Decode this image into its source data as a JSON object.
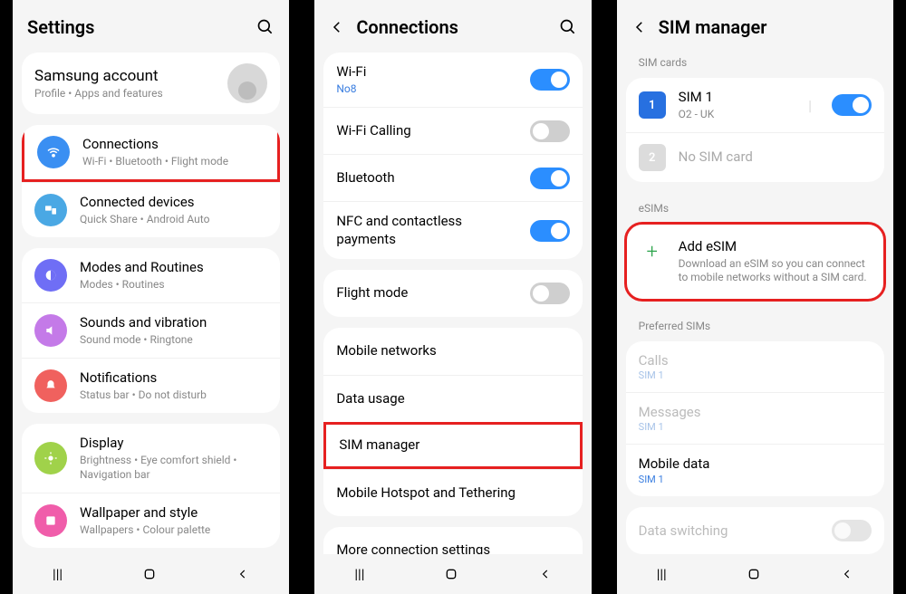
{
  "p1": {
    "title": "Settings",
    "account": {
      "title": "Samsung account",
      "sub": "Profile  •  Apps and features"
    },
    "g1": [
      {
        "label": "Connections",
        "sub": "Wi-Fi  •  Bluetooth  •  Flight mode",
        "color": "#3a8ff2"
      },
      {
        "label": "Connected devices",
        "sub": "Quick Share  •  Android Auto",
        "color": "#4aa8e4"
      }
    ],
    "g2": [
      {
        "label": "Modes and Routines",
        "sub": "Modes  •  Routines",
        "color": "#6f6ef5"
      },
      {
        "label": "Sounds and vibration",
        "sub": "Sound mode  •  Ringtone",
        "color": "#c47ae8"
      },
      {
        "label": "Notifications",
        "sub": "Status bar  •  Do not disturb",
        "color": "#f0615e"
      }
    ],
    "g3": [
      {
        "label": "Display",
        "sub": "Brightness  •  Eye comfort shield  •  Navigation bar",
        "color": "#a0d24a"
      },
      {
        "label": "Wallpaper and style",
        "sub": "Wallpapers  •  Colour palette",
        "color": "#f05daa"
      }
    ]
  },
  "p2": {
    "title": "Connections",
    "g1": [
      {
        "label": "Wi-Fi",
        "sub": "No8",
        "toggle": "on"
      },
      {
        "label": "Wi-Fi Calling",
        "toggle": "off"
      },
      {
        "label": "Bluetooth",
        "toggle": "on"
      },
      {
        "label": "NFC and contactless payments",
        "toggle": "on"
      }
    ],
    "g2": [
      {
        "label": "Flight mode",
        "toggle": "off"
      }
    ],
    "g3": [
      {
        "label": "Mobile networks"
      },
      {
        "label": "Data usage"
      },
      {
        "label": "SIM manager"
      },
      {
        "label": "Mobile Hotspot and Tethering"
      }
    ],
    "g4": [
      {
        "label": "More connection settings"
      }
    ]
  },
  "p3": {
    "title": "SIM manager",
    "sec_sim": "SIM cards",
    "sim1": {
      "num": "1",
      "label": "SIM 1",
      "sub": "O2 - UK",
      "toggle": "on"
    },
    "sim2": {
      "num": "2",
      "label": "No SIM card"
    },
    "sec_esim": "eSIMs",
    "addesim": {
      "label": "Add eSIM",
      "sub": "Download an eSIM so you can connect to mobile networks without a SIM card."
    },
    "sec_pref": "Preferred SIMs",
    "pref": [
      {
        "label": "Calls",
        "sub": "SIM 1",
        "disabled": true
      },
      {
        "label": "Messages",
        "sub": "SIM 1",
        "disabled": true
      },
      {
        "label": "Mobile data",
        "sub": "SIM 1",
        "disabled": false
      }
    ],
    "switch": {
      "label": "Data switching",
      "toggle": "off-dis"
    }
  }
}
